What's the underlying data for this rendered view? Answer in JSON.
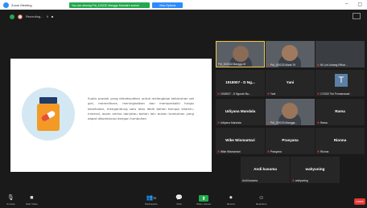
{
  "titlebar": {
    "app_title": "Zoom Meeting",
    "share_banner": "You are viewing Pdl_100232 Manggo Mandal's screen",
    "view_options": "View Options",
    "min_label": "–",
    "restore_label": "▢"
  },
  "recording": {
    "label": "Recording...",
    "pause": "II",
    "stop": "■"
  },
  "slide": {
    "text": "Suatu produk yang dimaksudkan untuk melengkapi kebutuhan zat gizi, memelihara, meningkatkan dan memperbaiki fungsi kesehatan, mengandung satu atau lebih bahan berupa vitamin, mineral, asam amino dan/atau bahan lain bukan tumbuhan yang dapat dikombinasi dengan tumbuhan"
  },
  "participants": [
    {
      "center": "",
      "tag": "Pdl_100232 Manggo M",
      "muted": false,
      "video": true
    },
    {
      "center": "",
      "tag": "Pdl_100233 Made Tri",
      "muted": true,
      "video": true
    },
    {
      "center": "",
      "tag": "NI Luh Lintang Effriar...",
      "muted": true,
      "video": false
    },
    {
      "center": "1918007 - D Ng...",
      "tag": "1918007 - D Ngurah Ba...",
      "muted": true,
      "video": false
    },
    {
      "center": "Yani",
      "tag": "Yani",
      "muted": true,
      "video": false
    },
    {
      "center": "T",
      "tag": "171002 Tisi Purnamasari",
      "muted": true,
      "video": false
    },
    {
      "center": "Udiyana Mandala",
      "tag": "Udiyana Mandala",
      "muted": true,
      "video": false
    },
    {
      "center": "",
      "tag": "Pdl_100233 Mangga...",
      "muted": true,
      "video": true
    },
    {
      "center": "Rama",
      "tag": "Rama",
      "muted": true,
      "video": false
    },
    {
      "center": "Wike Wismantari",
      "tag": "Wike Wismantari",
      "muted": true,
      "video": false
    },
    {
      "center": "Prasyana",
      "tag": "Prasyana",
      "muted": true,
      "video": false
    },
    {
      "center": "Rionna",
      "tag": "Rionna",
      "muted": true,
      "video": false
    },
    {
      "center": "Andi kusuma",
      "tag": "Andi kusuma",
      "muted": false,
      "video": false
    },
    {
      "center": "wahyuning",
      "tag": "wahyuning",
      "muted": true,
      "video": false
    }
  ],
  "toolbar": {
    "mute": "Unmute",
    "video": "Start Video",
    "participants": "Participants",
    "participants_count": "29",
    "chat": "Chat",
    "share": "Share Screen",
    "record": "Record",
    "reactions": "Reactions",
    "leave": "Leave"
  }
}
